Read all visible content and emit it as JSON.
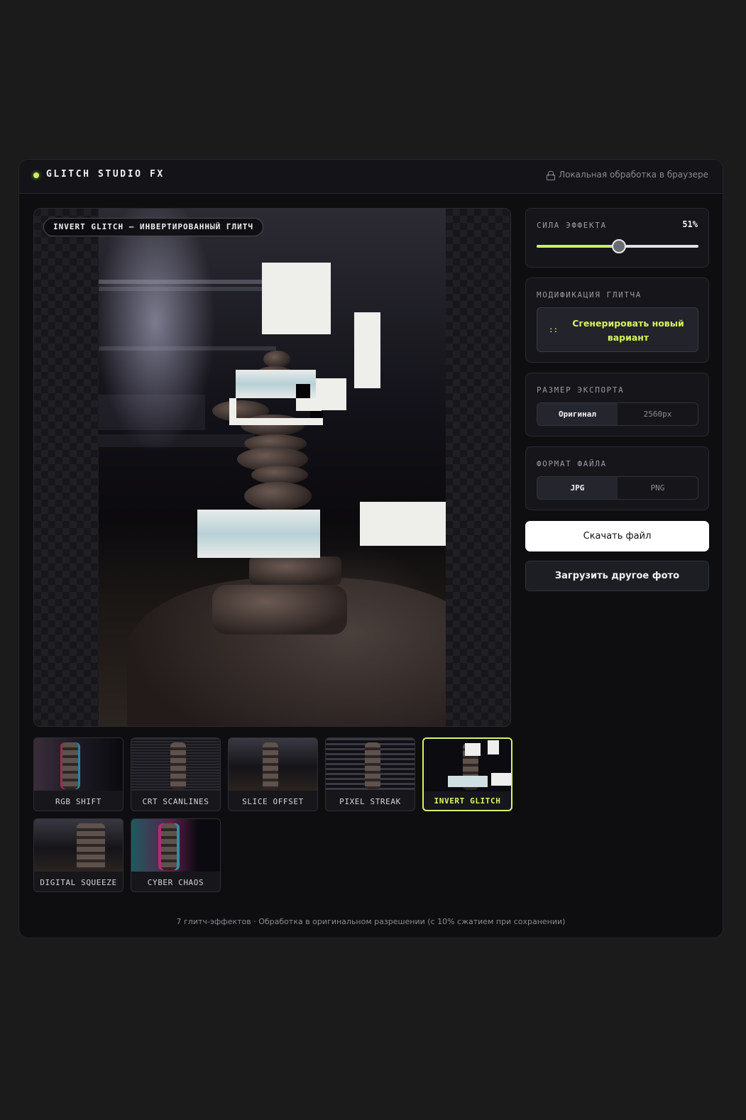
{
  "header": {
    "brand": "GLITCH STUDIO FX",
    "local_processing": "Локальная обработка в браузере",
    "lock_icon": "lock-icon",
    "accent_color": "#c8f25a"
  },
  "preview": {
    "badge": "INVERT GLITCH — ИНВЕРТИРОВАННЫЙ ГЛИТЧ"
  },
  "effects": [
    {
      "label": "RGB SHIFT",
      "active": false
    },
    {
      "label": "CRT SCANLINES",
      "active": false
    },
    {
      "label": "SLICE OFFSET",
      "active": false
    },
    {
      "label": "PIXEL STREAK",
      "active": false
    },
    {
      "label": "INVERT GLITCH",
      "active": true
    },
    {
      "label": "DIGITAL SQUEEZE",
      "active": false
    },
    {
      "label": "CYBER CHAOS",
      "active": false
    }
  ],
  "strength": {
    "title": "СИЛА ЭФФЕКТА",
    "value_label": "51%",
    "value": 0.51
  },
  "modify": {
    "title": "МОДИФИКАЦИЯ ГЛИТЧА",
    "icon": "::",
    "button": "Сгенерировать новый вариант"
  },
  "export_size": {
    "title": "РАЗМЕР ЭКСПОРТА",
    "options": [
      "Оригинал",
      "2560px"
    ],
    "selected": "Оригинал"
  },
  "file_format": {
    "title": "ФОРМАТ ФАЙЛА",
    "options": [
      "JPG",
      "PNG"
    ],
    "selected": "JPG"
  },
  "actions": {
    "download": "Скачать файл",
    "upload": "Загрузить другое фото"
  },
  "footer": "7 глитч-эффектов · Обработка в оригинальном разрешении (с 10% сжатием при сохранении)"
}
